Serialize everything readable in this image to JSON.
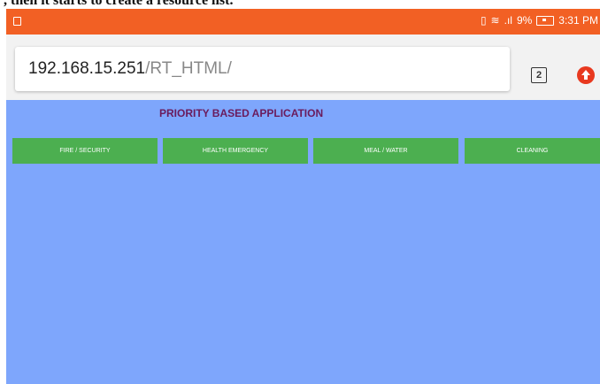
{
  "caption": {
    "text": ", then it starts to create a resource list."
  },
  "status_bar": {
    "background_color": "#f26024",
    "signal_text": ".ıl",
    "battery_percent": "9%",
    "time": "3:31 PM"
  },
  "browser": {
    "url_host": "192.168.15.251",
    "url_path": "/RT_HTML/",
    "tab_count": "2"
  },
  "page": {
    "background_color": "#7ea6fc",
    "title": "PRIORITY BASED APPLICATION",
    "buttons": [
      {
        "label": "FIRE / SECURITY"
      },
      {
        "label": "HEALTH EMERGENCY"
      },
      {
        "label": "MEAL / WATER"
      },
      {
        "label": "CLEANING"
      }
    ],
    "button_color": "#4caf50"
  }
}
